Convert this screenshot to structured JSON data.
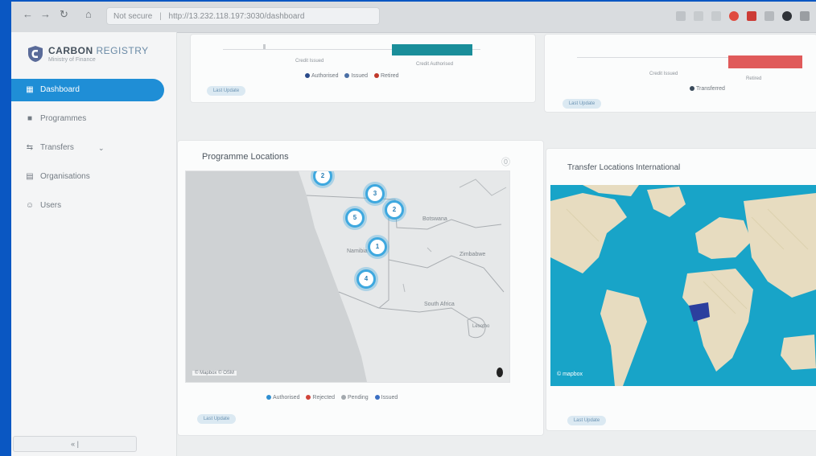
{
  "browser": {
    "address_secure_label": "Not secure",
    "address_url": "http://13.232.118.197:3030/dashboard"
  },
  "sidebar": {
    "brand_name": "CARBON",
    "brand_suffix": "REGISTRY",
    "brand_tagline": "Ministry of Finance",
    "items": [
      {
        "label": "Dashboard",
        "icon": "grid-icon"
      },
      {
        "label": "Programmes",
        "icon": "folder-icon"
      },
      {
        "label": "Transfers",
        "icon": "swap-icon"
      },
      {
        "label": "Organisations",
        "icon": "building-icon"
      },
      {
        "label": "Users",
        "icon": "user-icon"
      }
    ],
    "collapse_label": "« |"
  },
  "top_left_card": {
    "axis_labels": [
      "Credit Issued",
      "Credit Authorised"
    ],
    "legend": [
      {
        "label": "Authorised",
        "color": "#2a4a8a"
      },
      {
        "label": "Issued",
        "color": "#4a6fa5"
      },
      {
        "label": "Retired",
        "color": "#c0392b"
      }
    ],
    "button": "Last Update"
  },
  "top_right_card": {
    "axis_labels": [
      "Credit Issued",
      "Retired"
    ],
    "legend": [
      {
        "label": "Transferred",
        "color": "#3a4a5a"
      }
    ],
    "button": "Last Update"
  },
  "map_card": {
    "title": "Programme Locations",
    "countries": [
      "Botswana",
      "Namibia",
      "Zimbabwe",
      "South Africa",
      "Lesotho"
    ],
    "clusters": [
      "2",
      "3",
      "2",
      "5",
      "1",
      "4"
    ],
    "legend": [
      {
        "label": "Authorised",
        "color": "#2f8fd1"
      },
      {
        "label": "Rejected",
        "color": "#d0443a"
      },
      {
        "label": "Pending",
        "color": "#a3a9ae"
      },
      {
        "label": "Issued",
        "color": "#3b6fc2"
      }
    ],
    "attribution": "© Mapbox © OSM",
    "button": "Last Update"
  },
  "world_card": {
    "title": "Transfer Locations International",
    "attribution": "© mapbox",
    "button": "Last Update"
  }
}
